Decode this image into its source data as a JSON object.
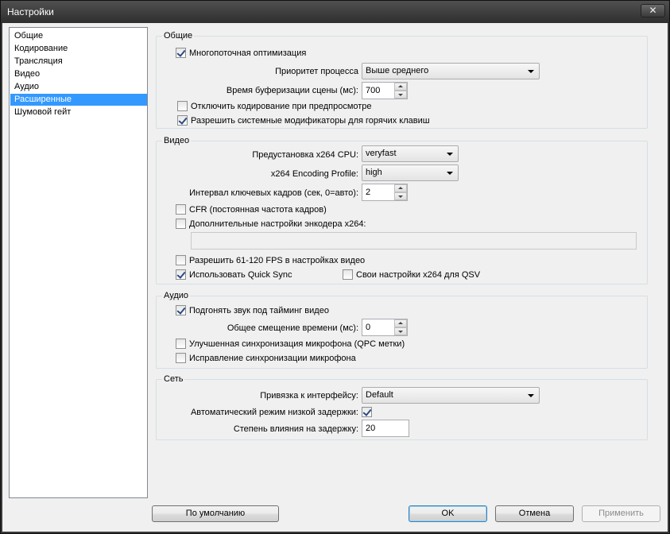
{
  "window": {
    "title": "Настройки",
    "close_symbol": "✕"
  },
  "nav": {
    "items": [
      {
        "label": "Общие"
      },
      {
        "label": "Кодирование"
      },
      {
        "label": "Трансляция"
      },
      {
        "label": "Видео"
      },
      {
        "label": "Аудио"
      },
      {
        "label": "Расширенные",
        "selected": true
      },
      {
        "label": "Шумовой гейт"
      }
    ]
  },
  "general": {
    "title": "Общие",
    "multithread_label": "Многопоточная оптимизация",
    "multithread_checked": true,
    "priority_label": "Приоритет процесса",
    "priority_value": "Выше среднего",
    "buffer_label": "Время буферизации сцены (мс):",
    "buffer_value": "700",
    "disable_preview_label": "Отключить кодирование при предпросмотре",
    "disable_preview_checked": false,
    "hotkey_modifiers_label": "Разрешить системные модификаторы для горячих клавиш",
    "hotkey_modifiers_checked": true
  },
  "video": {
    "title": "Видео",
    "preset_label": "Предустановка x264 CPU:",
    "preset_value": "veryfast",
    "profile_label": "x264 Encoding Profile:",
    "profile_value": "high",
    "keyframe_label": "Интервал ключевых кадров (сек, 0=авто):",
    "keyframe_value": "2",
    "cfr_label": "CFR (постоянная частота кадров)",
    "cfr_checked": false,
    "custom_x264_label": "Дополнительные настройки энкодера x264:",
    "custom_x264_checked": false,
    "custom_x264_value": "",
    "fps_label": "Разрешить 61-120 FPS в настройках видео",
    "fps_checked": false,
    "quicksync_label": "Использовать Quick Sync",
    "quicksync_checked": true,
    "qsv_custom_label": "Свои настройки x264 для QSV",
    "qsv_custom_checked": false
  },
  "audio": {
    "title": "Аудио",
    "sync_label": "Подгонять звук под тайминг видео",
    "sync_checked": true,
    "offset_label": "Общее смещение времени (мс):",
    "offset_value": "0",
    "mic_sync_label": "Улучшенная синхронизация микрофона (QPC метки)",
    "mic_sync_checked": false,
    "mic_fix_label": "Исправление синхронизации микрофона",
    "mic_fix_checked": false
  },
  "network": {
    "title": "Сеть",
    "bind_label": "Привязка к интерфейсу:",
    "bind_value": "Default",
    "low_latency_label": "Автоматический режим низкой задержки:",
    "low_latency_checked": true,
    "latency_factor_label": "Степень влияния на задержку:",
    "latency_factor_value": "20"
  },
  "buttons": {
    "defaults": "По умолчанию",
    "ok": "OK",
    "cancel": "Отмена",
    "apply": "Применить"
  },
  "icons": {
    "close": "close-icon",
    "dropdown": "chevron-down-icon",
    "spin_up": "arrow-up-icon",
    "spin_down": "arrow-down-icon"
  },
  "colors": {
    "selection": "#3399ff",
    "titlebar": "#3a3a3a",
    "checkmark": "#2b4a82"
  }
}
